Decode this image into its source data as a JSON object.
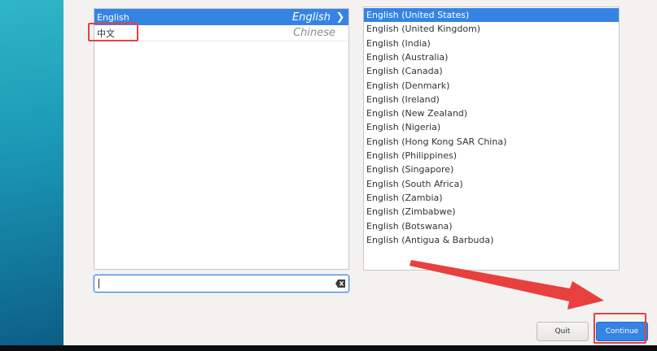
{
  "languages": [
    {
      "name": "English",
      "native": "English",
      "selected": true
    },
    {
      "name": "中文",
      "native": "Chinese",
      "selected": false
    }
  ],
  "locales": [
    "English (United States)",
    "English (United Kingdom)",
    "English (India)",
    "English (Australia)",
    "English (Canada)",
    "English (Denmark)",
    "English (Ireland)",
    "English (New Zealand)",
    "English (Nigeria)",
    "English (Hong Kong SAR China)",
    "English (Philippines)",
    "English (Singapore)",
    "English (South Africa)",
    "English (Zambia)",
    "English (Zimbabwe)",
    "English (Botswana)",
    "English (Antigua & Barbuda)"
  ],
  "selected_locale_index": 0,
  "search": {
    "value": "",
    "placeholder": ""
  },
  "buttons": {
    "quit_label": "Quit",
    "continue_label": "Continue"
  },
  "colors": {
    "accent": "#3584e4",
    "annotation": "#e8403f"
  },
  "icons": {
    "expand": "chevron-right-icon",
    "clear": "clear-text-icon"
  }
}
